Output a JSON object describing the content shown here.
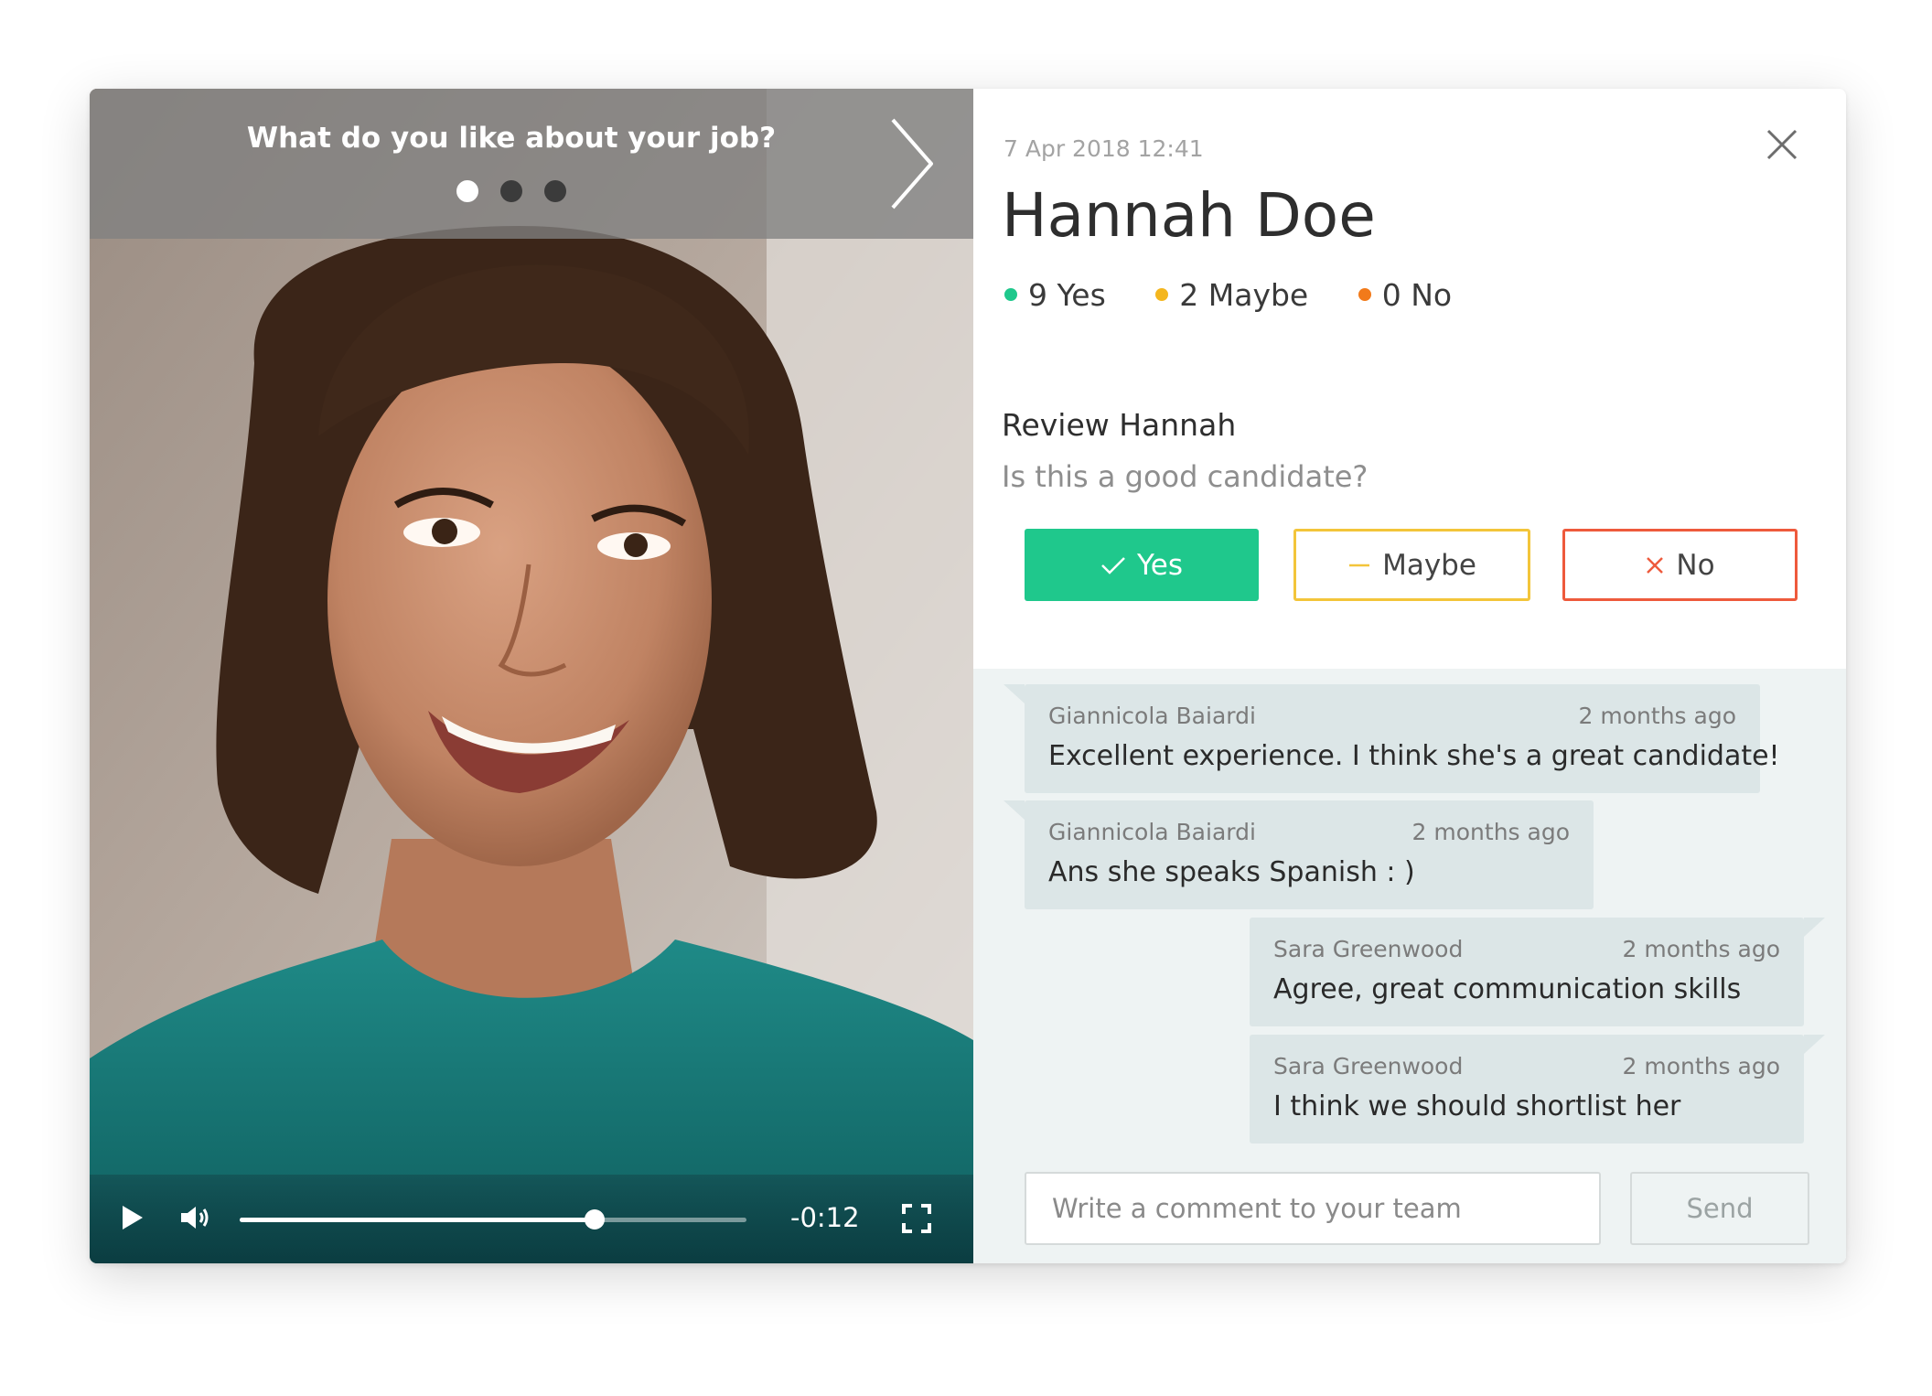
{
  "video": {
    "question": "What do you like about your job?",
    "question_dots": [
      true,
      false,
      false
    ],
    "next_icon": "chevron-right-icon",
    "time_remaining": "-0:12",
    "progress": 0.7,
    "controls": [
      "play-icon",
      "volume-icon",
      "fullscreen-icon"
    ]
  },
  "candidate": {
    "date": "7 Apr 2018 12:41",
    "name": "Hannah Doe",
    "tally": [
      {
        "label": "9 Yes",
        "color": "#1fc88c"
      },
      {
        "label": "2 Maybe",
        "color": "#f4b61e"
      },
      {
        "label": "0 No",
        "color": "#f27a1a"
      }
    ]
  },
  "review": {
    "title": "Review Hannah",
    "question": "Is this a good candidate?",
    "yes_label": "Yes",
    "maybe_label": "Maybe",
    "no_label": "No"
  },
  "comments": [
    {
      "author": "Giannicola Baiardi",
      "time": "2 months ago",
      "text": "Excellent experience. I think she's a great candidate!"
    },
    {
      "author": "Giannicola Baiardi",
      "time": "2 months ago",
      "text": "Ans she speaks Spanish : )"
    },
    {
      "author": "Sara Greenwood",
      "time": "2 months ago",
      "text": "Agree, great communication skills"
    },
    {
      "author": "Sara Greenwood",
      "time": "2 months ago",
      "text": "I think we should shortlist her"
    }
  ],
  "compose": {
    "placeholder": "Write a comment to your team",
    "send_label": "Send"
  },
  "colors": {
    "accent_green": "#1fc88c",
    "maybe_yellow": "#f3c53a",
    "no_red": "#ee5a3c",
    "comments_bg": "#eef3f3",
    "bubble_bg": "#dce6e7"
  }
}
